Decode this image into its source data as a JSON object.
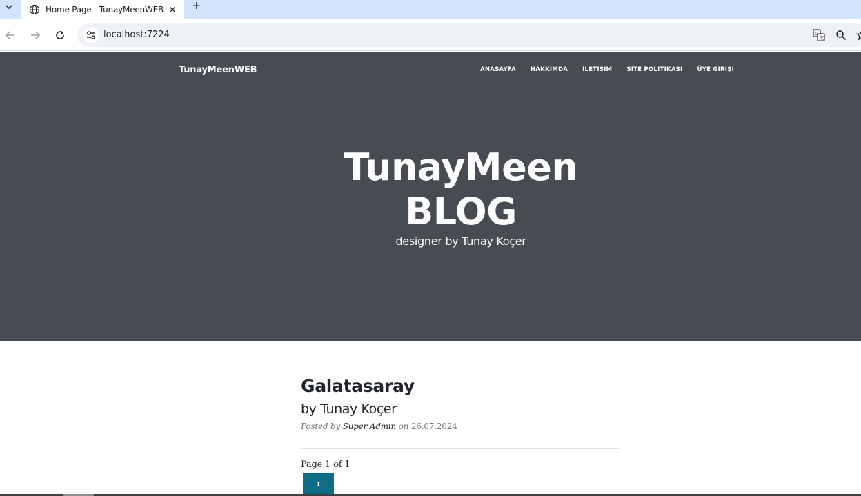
{
  "browser": {
    "tab_title": "Home Page - TunayMeenWEB",
    "tab_close": "✕",
    "new_tab": "+",
    "url": "localhost:7224"
  },
  "site": {
    "brand": "TunayMeenWEB",
    "nav": [
      "ANASAYFA",
      "HAKKIMDA",
      "İLETISIM",
      "SITE POLITIKASI",
      "ÜYE GIRIŞI"
    ],
    "hero": {
      "title_line1": "TunayMeen",
      "title_line2": "BLOG",
      "subtitle": "designer by Tunay Koçer"
    }
  },
  "post": {
    "title": "Galatasaray",
    "subtitle": "by Tunay Koçer",
    "posted_by_label": "Posted by",
    "author": "Super Admin",
    "on_label": "on",
    "date": "26.07.2024"
  },
  "pager": {
    "text": "Page 1 of 1",
    "current": "1"
  },
  "colors": {
    "hero_bg": "#474b52",
    "tab_strip": "#d3e3fd",
    "page_button": "#0d6e86"
  },
  "icons": [
    "chevron-down-icon",
    "globe-icon",
    "close-icon",
    "back-icon",
    "forward-icon",
    "reload-icon",
    "site-info-icon",
    "translate-icon",
    "zoom-icon",
    "star-icon"
  ]
}
